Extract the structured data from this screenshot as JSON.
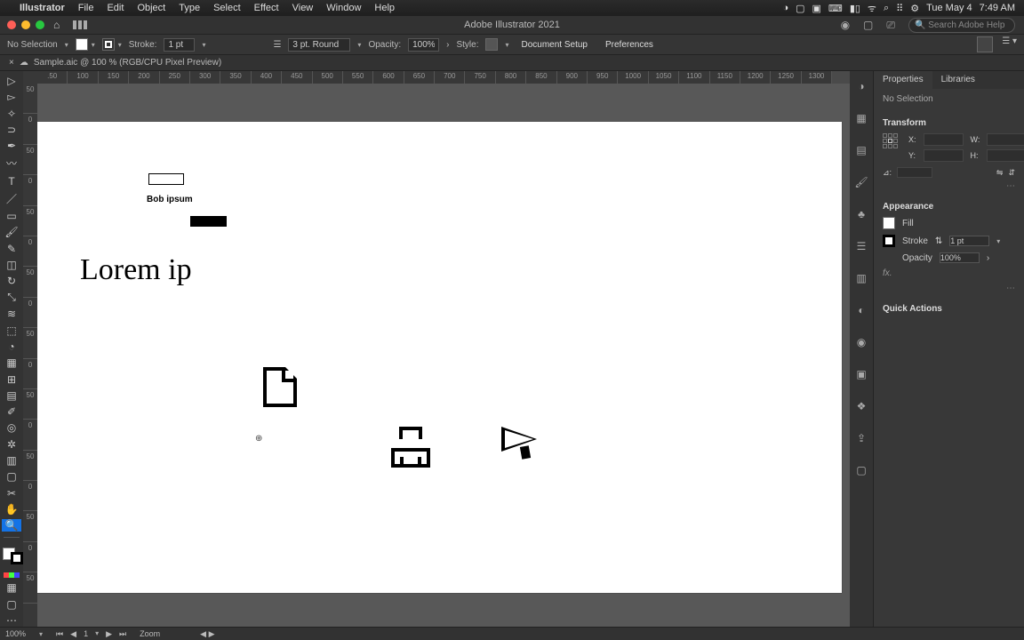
{
  "menubar": {
    "app_name": "Illustrator",
    "items": [
      "File",
      "Edit",
      "Object",
      "Type",
      "Select",
      "Effect",
      "View",
      "Window",
      "Help"
    ],
    "date": "Tue May 4",
    "time": "7:49 AM"
  },
  "window": {
    "title": "Adobe Illustrator 2021",
    "search_placeholder": "Search Adobe Help"
  },
  "control_bar": {
    "selection_label": "No Selection",
    "stroke_label": "Stroke:",
    "stroke_weight": "1 pt",
    "brush_preset": "3 pt. Round",
    "opacity_label": "Opacity:",
    "opacity_value": "100%",
    "style_label": "Style:",
    "doc_setup": "Document Setup",
    "preferences": "Preferences"
  },
  "doc_tab": {
    "name": "Sample.aic @ 100 % (RGB/CPU Pixel Preview)"
  },
  "ruler_top": [
    ".50",
    "100",
    "150",
    "200",
    "250",
    "300",
    "350",
    "400",
    "450",
    "500",
    "550",
    "600",
    "650",
    "700",
    "750",
    "800",
    "850",
    "900",
    "950",
    "1000",
    "1050",
    "1100",
    "1150",
    "1200",
    "1250",
    "1300"
  ],
  "ruler_left": [
    "50",
    "0",
    "50",
    "0",
    "50",
    "0",
    "50",
    "0",
    "50",
    "0",
    "50",
    "0",
    "50",
    "0",
    "50",
    "0",
    "50"
  ],
  "canvas": {
    "text_bob": "Bob ipsum",
    "text_lorem": "Lorem ip"
  },
  "props": {
    "tab_properties": "Properties",
    "tab_libraries": "Libraries",
    "no_selection": "No Selection",
    "transform_heading": "Transform",
    "labels": {
      "x": "X:",
      "y": "Y:",
      "w": "W:",
      "h": "H:",
      "angle": "⊿:"
    },
    "appearance_heading": "Appearance",
    "fill_label": "Fill",
    "stroke_label": "Stroke",
    "stroke_value": "1 pt",
    "opacity_label": "Opacity",
    "opacity_value": "100%",
    "fx_label": "fx.",
    "quick_actions": "Quick Actions"
  },
  "status_bar": {
    "zoom": "100%",
    "artboard": "1",
    "tool_hint": "Zoom"
  }
}
